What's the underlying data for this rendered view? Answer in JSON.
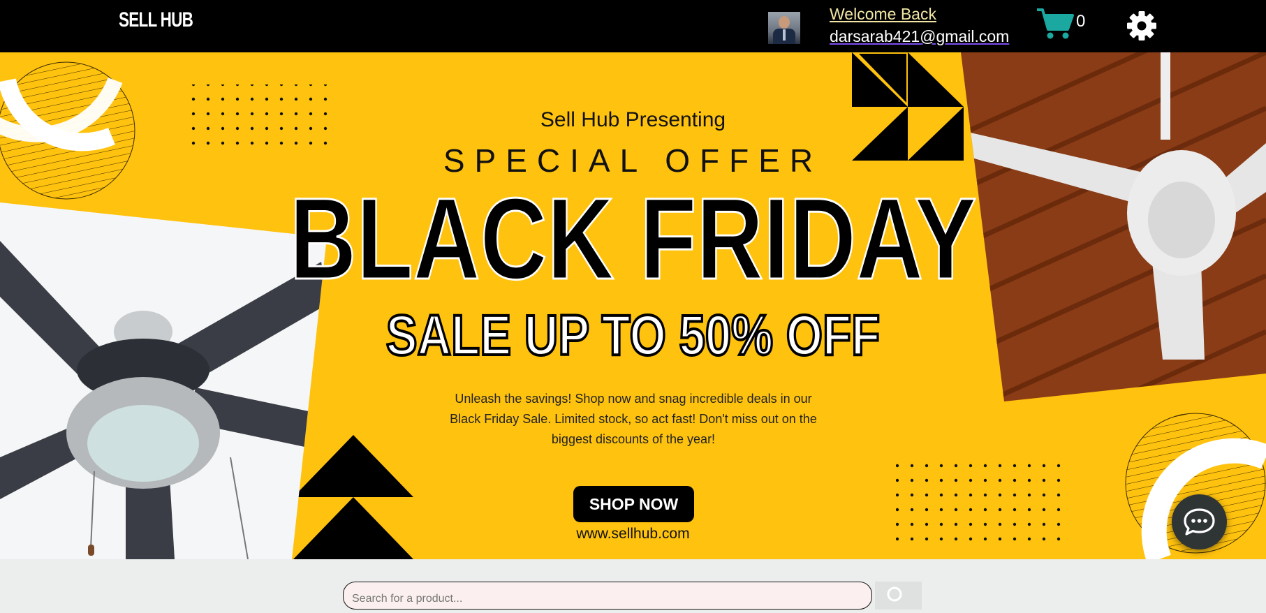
{
  "header": {
    "logo": "SELL HUB",
    "welcome": "Welcome Back",
    "email": "darsarab421@gmail.com",
    "cart_count": "0",
    "cart_icon": "cart-icon",
    "settings_icon": "gear-icon",
    "accent_color": "#1aa8a0"
  },
  "banner": {
    "presenting": "Sell Hub Presenting",
    "special": "SPECIAL OFFER",
    "headline": "BLACK FRIDAY",
    "sale": "SALE UP TO 50% OFF",
    "description": "Unleash the savings! Shop now and snag incredible deals in our Black Friday Sale. Limited stock, so act fast! Don't miss out on the biggest discounts of the year!",
    "cta": "SHOP NOW",
    "website": "www.sellhub.com",
    "background_color": "#ffc20e"
  },
  "search": {
    "placeholder": "Search for a product..."
  },
  "chat": {
    "icon": "chat-bubble-icon"
  }
}
